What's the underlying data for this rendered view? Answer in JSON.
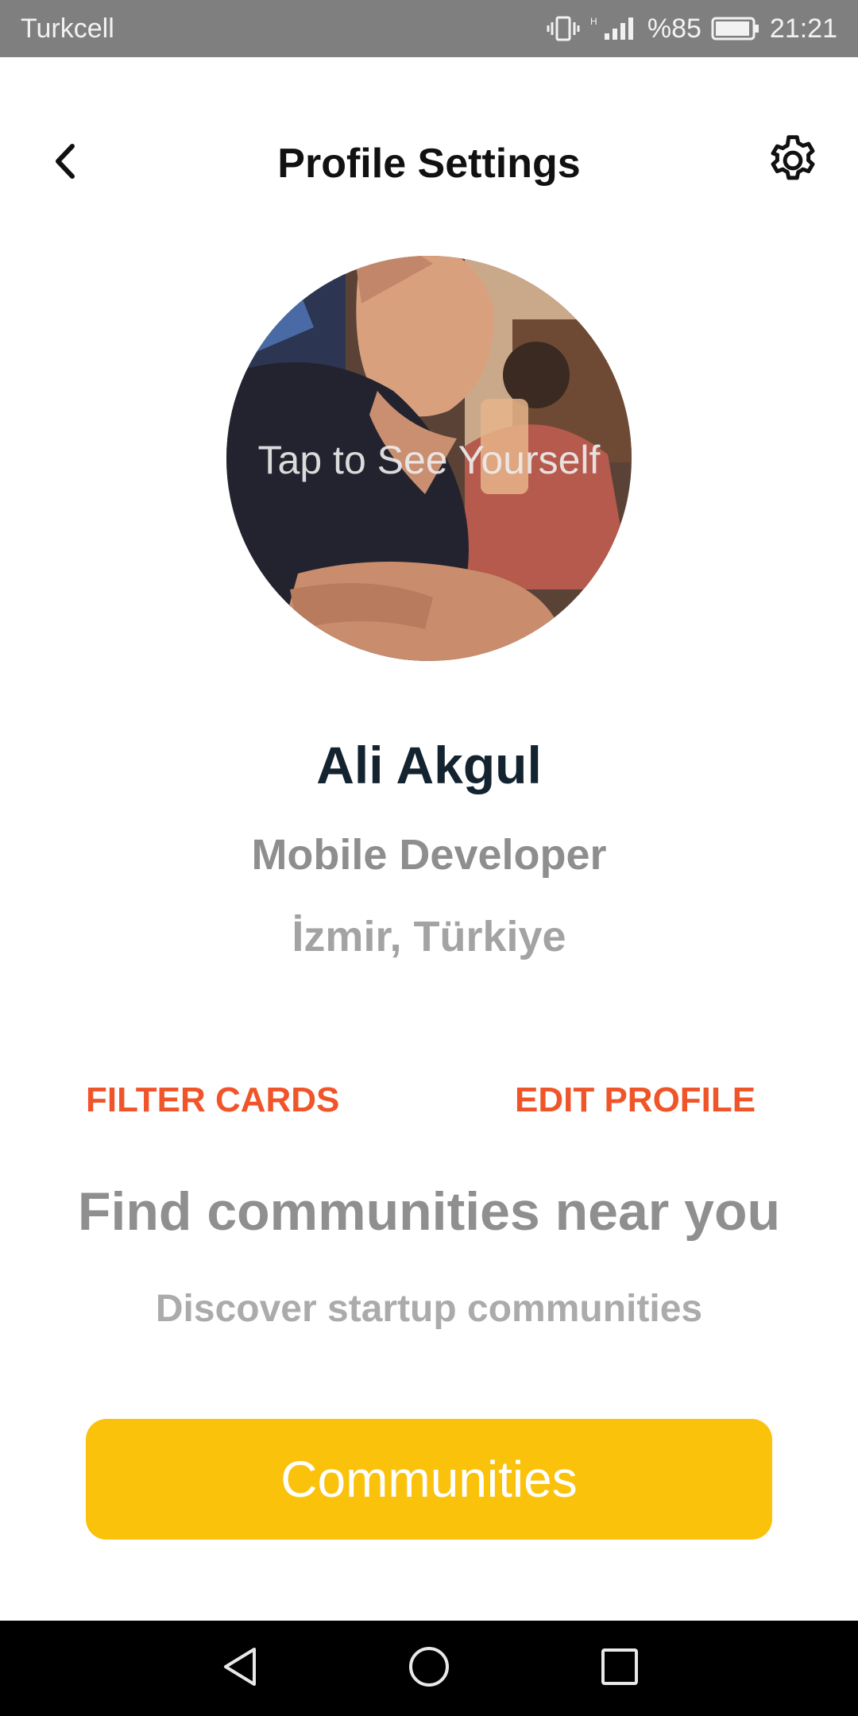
{
  "status_bar": {
    "carrier": "Turkcell",
    "battery": "%85",
    "time": "21:21",
    "icons": [
      "vibrate-icon",
      "signal-icon",
      "battery-icon"
    ]
  },
  "header": {
    "title": "Profile Settings",
    "back_icon": "chevron-left-icon",
    "settings_icon": "gear-icon"
  },
  "avatar": {
    "hint": "Tap to See Yourself"
  },
  "profile": {
    "name": "Ali Akgul",
    "role": "Mobile Developer",
    "location": "İzmir, Türkiye"
  },
  "actions": {
    "filter_cards": "FILTER CARDS",
    "edit_profile": "EDIT PROFILE"
  },
  "communities": {
    "heading": "Find communities near you",
    "subtitle": "Discover startup communities",
    "button_label": "Communities"
  },
  "nav_bar": {
    "icons": [
      "nav-back-icon",
      "nav-home-icon",
      "nav-recents-icon"
    ]
  },
  "colors": {
    "accent_orange": "#f0552a",
    "button_yellow": "#fbc20b",
    "status_bar": "#7f7f7f"
  }
}
